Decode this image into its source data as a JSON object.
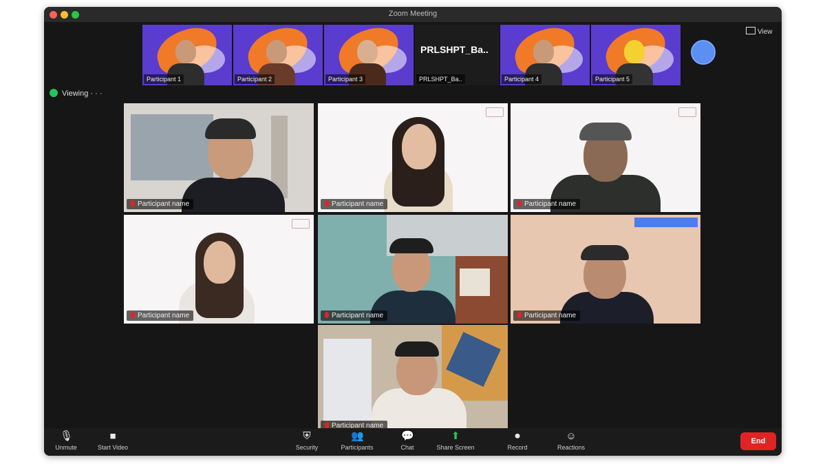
{
  "window": {
    "title": "Zoom Meeting"
  },
  "top_strip": {
    "tiles": [
      {
        "name": "Participant 1"
      },
      {
        "name": "Participant 2"
      },
      {
        "name": "Participant 3"
      },
      {
        "name": "Participant 4"
      },
      {
        "name": "Participant 5"
      }
    ],
    "text_tile": {
      "big": "PRLSHPT_Ba..",
      "name": "PRLSHPT_Ba.."
    }
  },
  "view_button": {
    "label": "View",
    "icon": "grid-icon"
  },
  "share_indicator": {
    "label": "Viewing · · ·",
    "icon": "green-dot-icon"
  },
  "gallery": {
    "tiles": [
      {
        "name": "Participant name",
        "icon": "mic-muted-icon"
      },
      {
        "name": "Participant name",
        "icon": "mic-muted-icon"
      },
      {
        "name": "Participant name",
        "icon": "mic-muted-icon"
      },
      {
        "name": "Participant name",
        "icon": "mic-muted-icon"
      },
      {
        "name": "Participant name",
        "icon": "mic-muted-icon"
      },
      {
        "name": "Participant name",
        "icon": "mic-muted-icon"
      },
      {
        "name": "Participant name",
        "icon": "mic-muted-icon"
      }
    ]
  },
  "toolbar": {
    "unmute": {
      "label": "Unmute",
      "icon": "microphone-icon"
    },
    "video": {
      "label": "Start Video",
      "icon": "camera-icon"
    },
    "security": {
      "label": "Security",
      "icon": "shield-icon"
    },
    "participants": {
      "label": "Participants",
      "icon": "people-icon"
    },
    "chat": {
      "label": "Chat",
      "icon": "chat-icon"
    },
    "share": {
      "label": "Share Screen",
      "icon": "share-screen-icon"
    },
    "record": {
      "label": "Record",
      "icon": "record-icon"
    },
    "reactions": {
      "label": "Reactions",
      "icon": "emoji-icon"
    },
    "end": {
      "label": "End"
    }
  },
  "colors": {
    "end": "#e02424",
    "share": "#22c55e",
    "accent": "#5b8ff2"
  }
}
